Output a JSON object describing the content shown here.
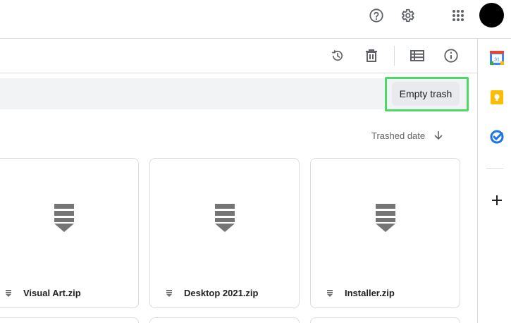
{
  "header": {
    "help_icon": "help-icon",
    "settings_icon": "gear-icon",
    "apps_icon": "apps-grid-icon",
    "avatar_color": "#000000"
  },
  "toolbar": {
    "restore_icon": "restore-icon",
    "delete_icon": "trash-icon",
    "list_view_icon": "list-view-icon",
    "info_icon": "info-icon"
  },
  "banner": {
    "empty_trash_label": "Empty trash",
    "highlight_color": "#4cd964"
  },
  "sort": {
    "label": "Trashed date",
    "direction_icon": "arrow-down-icon"
  },
  "files": [
    {
      "name": "Visual Art.zip",
      "icon": "zip-file-icon"
    },
    {
      "name": "Desktop 2021.zip",
      "icon": "zip-file-icon"
    },
    {
      "name": "Installer.zip",
      "icon": "zip-file-icon"
    }
  ],
  "side_panel": {
    "calendar_day": "31",
    "items": [
      "calendar-icon",
      "keep-icon",
      "tasks-icon",
      "add-icon"
    ]
  }
}
